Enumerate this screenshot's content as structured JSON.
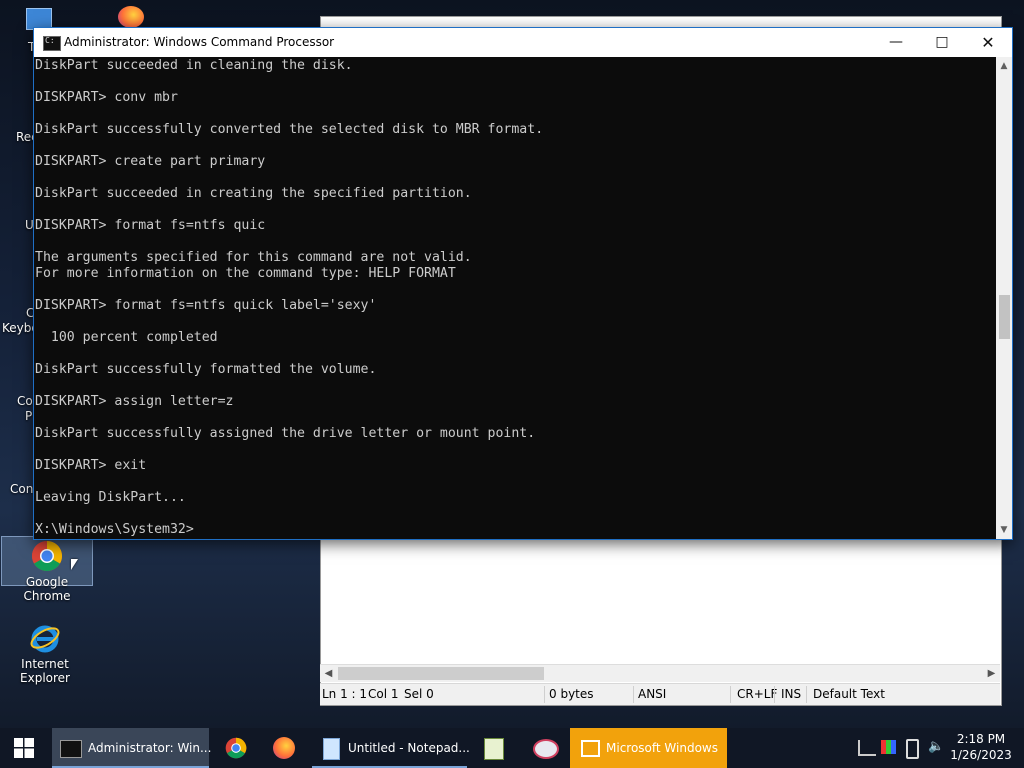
{
  "desktop_icons": [
    {
      "name": "Google Chrome",
      "selected": true
    },
    {
      "name": "Internet Explorer",
      "selected": false
    }
  ],
  "desktop_partial_labels": [
    "T",
    "Rec",
    "U",
    "C",
    "Keybo",
    "Co",
    "P",
    "Con"
  ],
  "notepad_status": {
    "position": "Ln 1 : 1",
    "col": "Col 1",
    "sel": "Sel 0",
    "size": "0 bytes",
    "encoding": "ANSI",
    "line_endings": "CR+LF",
    "mode": "INS",
    "style": "Default Text"
  },
  "cmd": {
    "title": "Administrator: Windows Command Processor",
    "lines": [
      "DiskPart succeeded in cleaning the disk.",
      "",
      "DISKPART> conv mbr",
      "",
      "DiskPart successfully converted the selected disk to MBR format.",
      "",
      "DISKPART> create part primary",
      "",
      "DiskPart succeeded in creating the specified partition.",
      "",
      "DISKPART> format fs=ntfs quic",
      "",
      "The arguments specified for this command are not valid.",
      "For more information on the command type: HELP FORMAT",
      "",
      "DISKPART> format fs=ntfs quick label='sexy'",
      "",
      "  100 percent completed",
      "",
      "DiskPart successfully formatted the volume.",
      "",
      "DISKPART> assign letter=z",
      "",
      "DiskPart successfully assigned the drive letter or mount point.",
      "",
      "DISKPART> exit",
      "",
      "Leaving DiskPart...",
      "",
      "X:\\Windows\\System32>"
    ]
  },
  "taskbar": {
    "buttons": [
      {
        "label": "Administrator: Win...",
        "icon": "cmd-icon"
      },
      {
        "label": "",
        "icon": "chrome-icon"
      },
      {
        "label": "",
        "icon": "firefox-icon"
      },
      {
        "label": "Untitled - Notepad...",
        "icon": "notepad-icon"
      },
      {
        "label": "",
        "icon": "image-editor-icon"
      },
      {
        "label": "",
        "icon": "paint-icon"
      },
      {
        "label": "Microsoft Windows",
        "icon": "window-list-icon"
      }
    ],
    "time": "2:18 PM",
    "date": "1/26/2023"
  },
  "colors": {
    "accent": "#1f6fc5",
    "taskbar": "#101725",
    "notify": "#f2a20c",
    "console_text": "#cccccc"
  }
}
